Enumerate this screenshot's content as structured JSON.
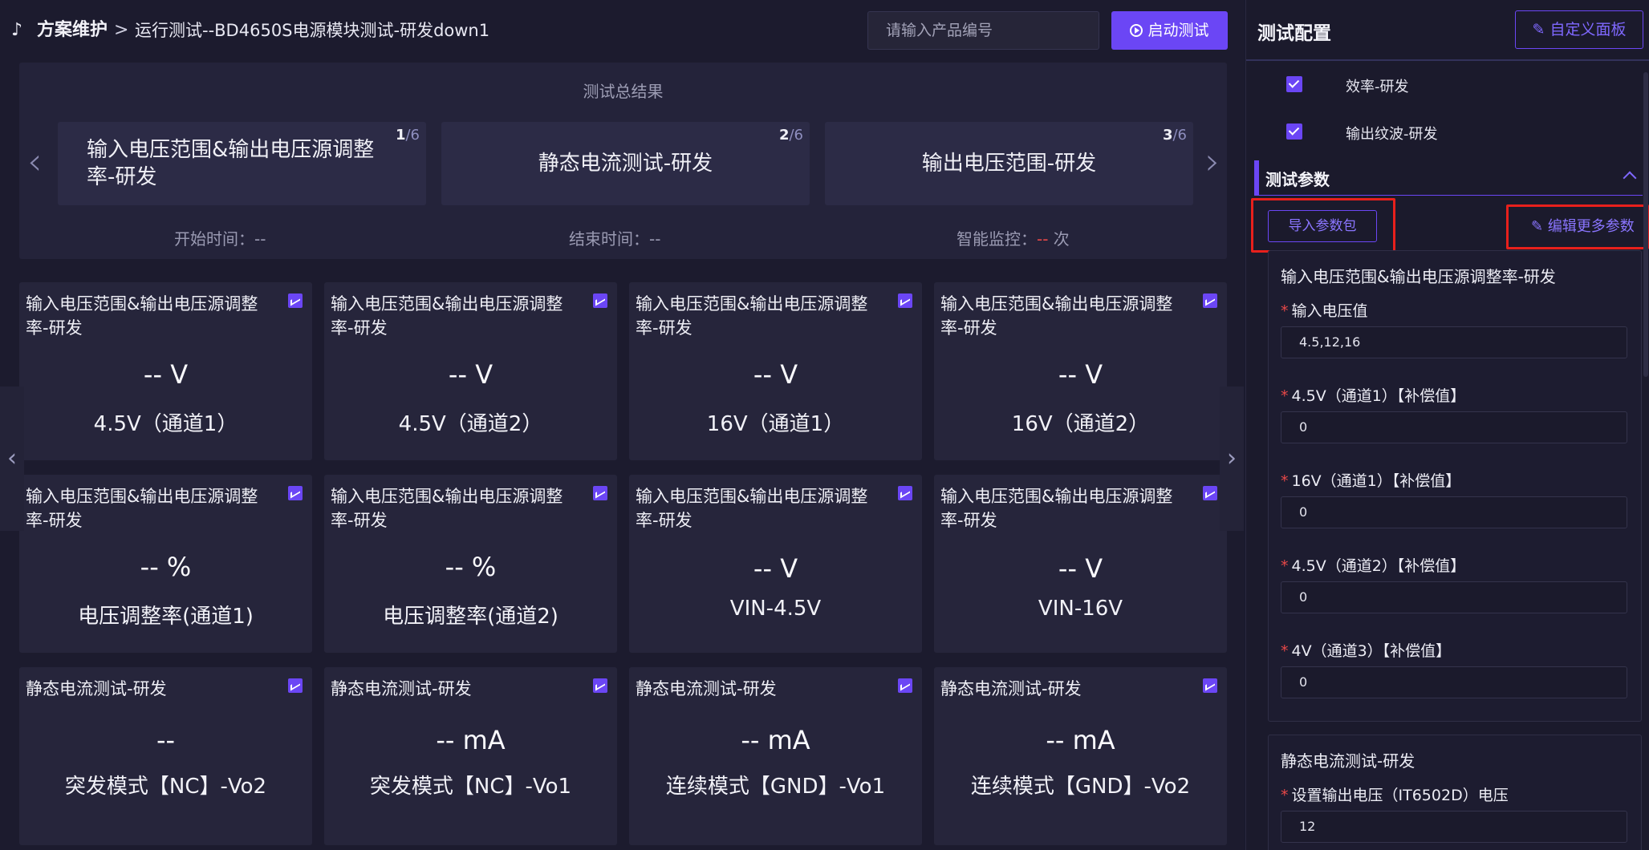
{
  "header": {
    "breadcrumb_root": "方案维护",
    "breadcrumb_sep": ">",
    "breadcrumb_current": "运行测试--BD4650S电源模块测试-研发down1",
    "search_placeholder": "请输入产品编号",
    "start_button": "启动测试"
  },
  "summary": {
    "title": "测试总结果",
    "cards": [
      {
        "label": "输入电压范围&输出电压源调整率-研发",
        "index": "1",
        "total": "/6"
      },
      {
        "label": "静态电流测试-研发",
        "index": "2",
        "total": "/6"
      },
      {
        "label": "输出电压范围-研发",
        "index": "3",
        "total": "/6"
      }
    ],
    "start_time_label": "开始时间：--",
    "end_time_label": "结束时间：--",
    "monitor_label": "智能监控：",
    "monitor_value": "--",
    "monitor_unit": " 次"
  },
  "cards": [
    {
      "title": "输入电压范围&输出电压源调整率-研发",
      "value": "--  V",
      "label": "4.5V（通道1）"
    },
    {
      "title": "输入电压范围&输出电压源调整率-研发",
      "value": "--  V",
      "label": "4.5V（通道2）"
    },
    {
      "title": "输入电压范围&输出电压源调整率-研发",
      "value": "--  V",
      "label": "16V（通道1）"
    },
    {
      "title": "输入电压范围&输出电压源调整率-研发",
      "value": "--  V",
      "label": "16V（通道2）"
    },
    {
      "title": "输入电压范围&输出电压源调整率-研发",
      "value": "--  %",
      "label": "电压调整率(通道1)"
    },
    {
      "title": "输入电压范围&输出电压源调整率-研发",
      "value": "--  %",
      "label": "电压调整率(通道2)"
    },
    {
      "title": "输入电压范围&输出电压源调整率-研发",
      "value": "--  V",
      "label": "VIN-4.5V"
    },
    {
      "title": "输入电压范围&输出电压源调整率-研发",
      "value": "--  V",
      "label": "VIN-16V"
    },
    {
      "title": "静态电流测试-研发",
      "value": "--",
      "label": "突发模式【NC】-Vo2"
    },
    {
      "title": "静态电流测试-研发",
      "value": "--  mA",
      "label": "突发模式【NC】-Vo1"
    },
    {
      "title": "静态电流测试-研发",
      "value": "--  mA",
      "label": "连续模式【GND】-Vo1"
    },
    {
      "title": "静态电流测试-研发",
      "value": "--  mA",
      "label": "连续模式【GND】-Vo2"
    }
  ],
  "panel": {
    "title": "测试配置",
    "custom_button": "自定义面板",
    "checked_items": [
      "效率-研发",
      "输出纹波-研发"
    ],
    "section_title": "测试参数",
    "import_button": "导入参数包",
    "edit_link": "编辑更多参数",
    "group1": {
      "title": "输入电压范围&输出电压源调整率-研发",
      "fields": [
        {
          "label": "输入电压值",
          "value": "4.5,12,16"
        },
        {
          "label": "4.5V（通道1）【补偿值】",
          "value": "0"
        },
        {
          "label": "16V（通道1）【补偿值】",
          "value": "0"
        },
        {
          "label": "4.5V（通道2）【补偿值】",
          "value": "0"
        },
        {
          "label": "4V（通道3）【补偿值】",
          "value": "0"
        }
      ]
    },
    "group2": {
      "title": "静态电流测试-研发",
      "fields": [
        {
          "label": "设置输出电压（IT6502D）电压",
          "value": "12"
        }
      ]
    }
  }
}
